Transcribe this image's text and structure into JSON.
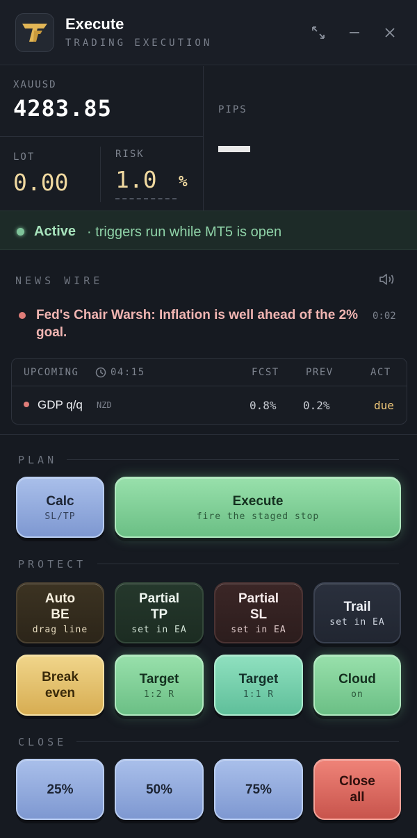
{
  "app": {
    "title": "Execute",
    "subtitle": "TRADING EXECUTION",
    "logo_icon": "tt-logo-icon",
    "window_controls": [
      "expand-icon",
      "minimize-icon",
      "close-icon"
    ]
  },
  "quote": {
    "symbol": "XAUUSD",
    "price": "4283.85",
    "lot_label": "LOT",
    "lot_value": "0.00",
    "risk_label": "RISK",
    "risk_value": "1.0",
    "risk_unit": "%",
    "pips_label": "PIPS"
  },
  "status": {
    "state": "Active",
    "description": "· triggers run while MT5 is open",
    "color": "#7fc49a"
  },
  "news": {
    "title": "NEWS WIRE",
    "headline": "Fed's Chair Warsh: Inflation is well ahead of the 2% goal.",
    "time": "0:02",
    "calendar": {
      "upcoming_label": "UPCOMING",
      "countdown": "04:15",
      "col_fcst": "FCST",
      "col_prev": "PREV",
      "col_act": "ACT",
      "event": {
        "name": "GDP q/q",
        "currency": "NZD",
        "fcst": "0.8%",
        "prev": "0.2%",
        "act": "due"
      }
    }
  },
  "plan": {
    "label": "PLAN",
    "calc": {
      "title": "Calc",
      "sub": "SL/TP"
    },
    "execute": {
      "title": "Execute",
      "sub": "fire the staged stop"
    }
  },
  "protect": {
    "label": "PROTECT",
    "auto_be": {
      "title1": "Auto",
      "title2": "BE",
      "sub": "drag line"
    },
    "partial_tp": {
      "title1": "Partial",
      "title2": "TP",
      "sub": "set in EA"
    },
    "partial_sl": {
      "title1": "Partial",
      "title2": "SL",
      "sub": "set in EA"
    },
    "trail": {
      "title": "Trail",
      "sub": "set in EA"
    },
    "break_even": {
      "title1": "Break",
      "title2": "even"
    },
    "target_2r": {
      "title": "Target",
      "sub": "1:2 R"
    },
    "target_1r": {
      "title": "Target",
      "sub": "1:1 R"
    },
    "cloud": {
      "title": "Cloud",
      "sub": "on"
    }
  },
  "close": {
    "label": "CLOSE",
    "p25": "25%",
    "p50": "50%",
    "p75": "75%",
    "all1": "Close",
    "all2": "all"
  }
}
